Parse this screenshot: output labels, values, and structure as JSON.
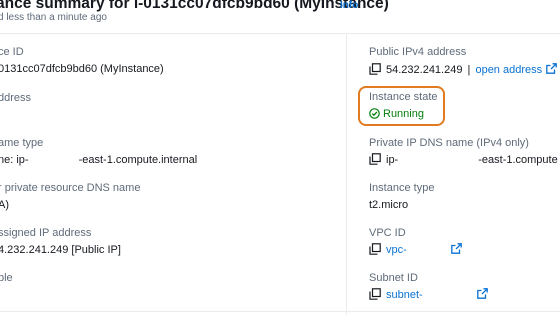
{
  "header": {
    "title": "ance summary for i-0131cc07dfcb9bd60 (MyInstance)",
    "info_label": "Info",
    "subtitle": "d less than a minute ago"
  },
  "left": [
    {
      "label": "ce ID",
      "value": "0131cc07dfcb9bd60 (MyInstance)"
    },
    {
      "label": "ddress",
      "value": ""
    },
    {
      "label": "ame type",
      "value_prefix": "ne: ip-",
      "value_suffix": "-east-1.compute.internal"
    },
    {
      "label": "r private resource DNS name",
      "value": "A)"
    },
    {
      "label": "ssigned IP address",
      "value": "4.232.241.249 [Public IP]"
    },
    {
      "label": "ble",
      "value": ""
    }
  ],
  "right": {
    "public_ipv4": {
      "label": "Public IPv4 address",
      "value": "54.232.241.249",
      "separator": "|",
      "link": "open address"
    },
    "instance_state": {
      "label": "Instance state",
      "value": "Running"
    },
    "private_dns": {
      "label": "Private IP DNS name (IPv4 only)",
      "value_prefix": "ip-",
      "value_suffix": "-east-1.compute"
    },
    "instance_type": {
      "label": "Instance type",
      "value": "t2.micro"
    },
    "vpc_id": {
      "label": "VPC ID",
      "value": "vpc-"
    },
    "subnet_id": {
      "label": "Subnet ID",
      "value": "subnet-"
    }
  },
  "colors": {
    "link": "#0972d3",
    "running": "#037f0c",
    "highlight": "#e07b22",
    "label": "#5f6b7a"
  },
  "icons": [
    "copy-icon",
    "external-link-icon",
    "check-circle-icon"
  ]
}
